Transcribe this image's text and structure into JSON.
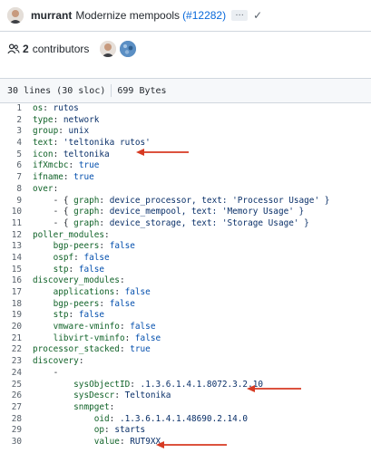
{
  "commit": {
    "author": "murrant",
    "message": "Modernize mempools",
    "pr": "(#12282)",
    "more_label": "…",
    "status_icon": "check-icon",
    "colors": {
      "link": "#0969da"
    }
  },
  "contributors": {
    "count": "2",
    "label": "contributors"
  },
  "file_info": {
    "lines": "30 lines (30 sloc)",
    "size": "699 Bytes"
  },
  "code": {
    "lines": [
      {
        "n": "1",
        "indent": "",
        "key": "os",
        "sep": ": ",
        "val": "rutos",
        "vt": "v"
      },
      {
        "n": "2",
        "indent": "",
        "key": "type",
        "sep": ": ",
        "val": "network",
        "vt": "v"
      },
      {
        "n": "3",
        "indent": "",
        "key": "group",
        "sep": ": ",
        "val": "unix",
        "vt": "v"
      },
      {
        "n": "4",
        "indent": "",
        "key": "text",
        "sep": ": ",
        "val": "'teltonika rutos'",
        "vt": "v"
      },
      {
        "n": "5",
        "indent": "",
        "key": "icon",
        "sep": ": ",
        "val": "teltonika",
        "vt": "v"
      },
      {
        "n": "6",
        "indent": "",
        "key": "ifXmcbc",
        "sep": ": ",
        "val": "true",
        "vt": "b"
      },
      {
        "n": "7",
        "indent": "",
        "key": "ifname",
        "sep": ": ",
        "val": "true",
        "vt": "b"
      },
      {
        "n": "8",
        "indent": "",
        "key": "over",
        "sep": ":",
        "val": "",
        "vt": "v"
      },
      {
        "n": "9",
        "indent": "    - { ",
        "key": "graph",
        "sep": ": ",
        "val": "device_processor, text: 'Processor Usage' }",
        "vt": "v"
      },
      {
        "n": "10",
        "indent": "    - { ",
        "key": "graph",
        "sep": ": ",
        "val": "device_mempool, text: 'Memory Usage' }",
        "vt": "v"
      },
      {
        "n": "11",
        "indent": "    - { ",
        "key": "graph",
        "sep": ": ",
        "val": "device_storage, text: 'Storage Usage' }",
        "vt": "v"
      },
      {
        "n": "12",
        "indent": "",
        "key": "poller_modules",
        "sep": ":",
        "val": "",
        "vt": "v"
      },
      {
        "n": "13",
        "indent": "    ",
        "key": "bgp-peers",
        "sep": ": ",
        "val": "false",
        "vt": "b"
      },
      {
        "n": "14",
        "indent": "    ",
        "key": "ospf",
        "sep": ": ",
        "val": "false",
        "vt": "b"
      },
      {
        "n": "15",
        "indent": "    ",
        "key": "stp",
        "sep": ": ",
        "val": "false",
        "vt": "b"
      },
      {
        "n": "16",
        "indent": "",
        "key": "discovery_modules",
        "sep": ":",
        "val": "",
        "vt": "v"
      },
      {
        "n": "17",
        "indent": "    ",
        "key": "applications",
        "sep": ": ",
        "val": "false",
        "vt": "b"
      },
      {
        "n": "18",
        "indent": "    ",
        "key": "bgp-peers",
        "sep": ": ",
        "val": "false",
        "vt": "b"
      },
      {
        "n": "19",
        "indent": "    ",
        "key": "stp",
        "sep": ": ",
        "val": "false",
        "vt": "b"
      },
      {
        "n": "20",
        "indent": "    ",
        "key": "vmware-vminfo",
        "sep": ": ",
        "val": "false",
        "vt": "b"
      },
      {
        "n": "21",
        "indent": "    ",
        "key": "libvirt-vminfo",
        "sep": ": ",
        "val": "false",
        "vt": "b"
      },
      {
        "n": "22",
        "indent": "",
        "key": "processor_stacked",
        "sep": ": ",
        "val": "true",
        "vt": "b"
      },
      {
        "n": "23",
        "indent": "",
        "key": "discovery",
        "sep": ":",
        "val": "",
        "vt": "v"
      },
      {
        "n": "24",
        "indent": "    -",
        "key": "",
        "sep": "",
        "val": "",
        "vt": "v"
      },
      {
        "n": "25",
        "indent": "        ",
        "key": "sysObjectID",
        "sep": ": ",
        "val": ".1.3.6.1.4.1.8072.3.2.10",
        "vt": "v"
      },
      {
        "n": "26",
        "indent": "        ",
        "key": "sysDescr",
        "sep": ": ",
        "val": "Teltonika",
        "vt": "v"
      },
      {
        "n": "27",
        "indent": "        ",
        "key": "snmpget",
        "sep": ":",
        "val": "",
        "vt": "v"
      },
      {
        "n": "28",
        "indent": "            ",
        "key": "oid",
        "sep": ": ",
        "val": ".1.3.6.1.4.1.48690.2.14.0",
        "vt": "v"
      },
      {
        "n": "29",
        "indent": "            ",
        "key": "op",
        "sep": ": ",
        "val": "starts",
        "vt": "v"
      },
      {
        "n": "30",
        "indent": "            ",
        "key": "value",
        "sep": ": ",
        "val": "RUT9XX",
        "vt": "v"
      }
    ]
  },
  "annotations": {
    "arrow_color": "#d73a22"
  }
}
